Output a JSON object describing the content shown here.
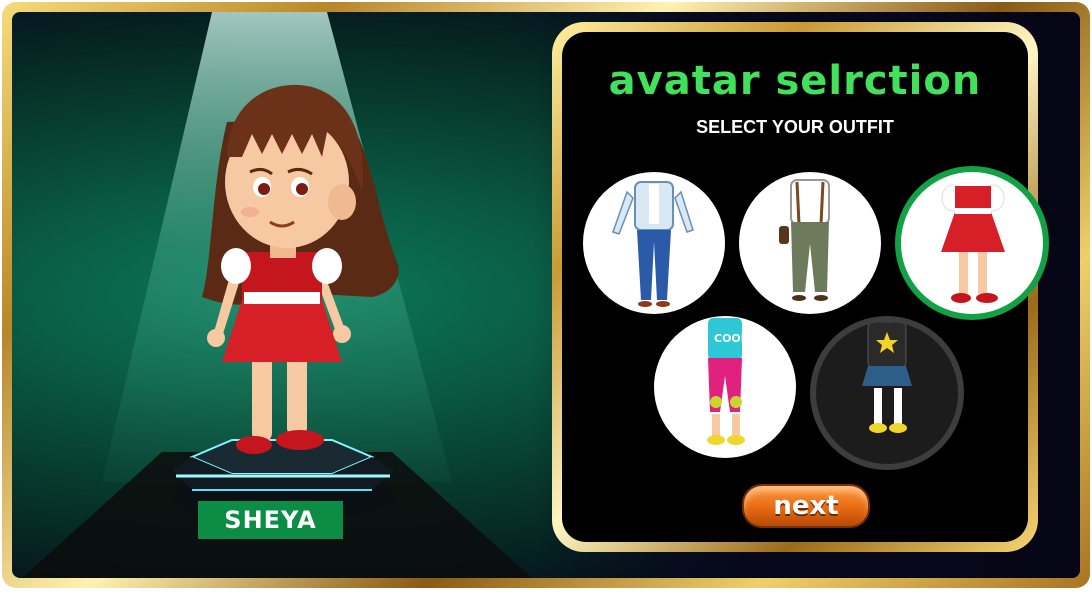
{
  "character": {
    "name": "SHEYA"
  },
  "panel": {
    "title": "avatar selrction",
    "subtitle": "SELECT YOUR OUTFIT"
  },
  "outfits": [
    {
      "id": "casual-jacket-jeans",
      "selected": false
    },
    {
      "id": "suspenders-cargo",
      "selected": false
    },
    {
      "id": "red-dress",
      "selected": true
    },
    {
      "id": "cool-skater",
      "selected": false
    },
    {
      "id": "star-hoodie-skirt",
      "selected": false
    }
  ],
  "next_button": {
    "label": "next"
  },
  "colors": {
    "title_green": "#41e15b",
    "selected_ring": "#12a145",
    "name_plate": "#0c8d46",
    "button_orange": "#e76a12",
    "frame_gold": "#c99a34"
  }
}
